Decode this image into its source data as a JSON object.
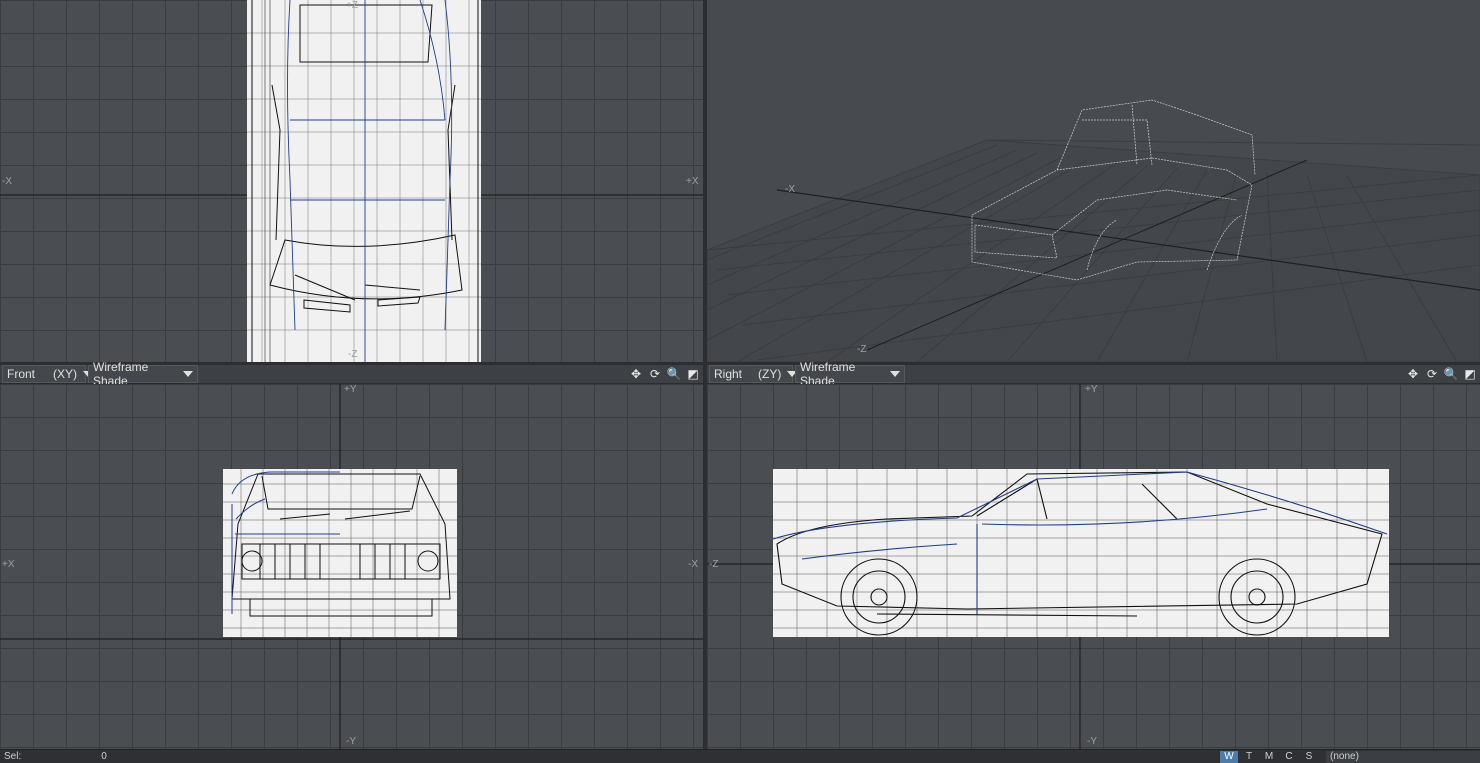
{
  "viewports": {
    "top_left": {
      "axis_labels": {
        "top": "+Z",
        "bottom": "-Z",
        "left": "-X",
        "right": "+X"
      }
    },
    "top_right": {
      "axis_labels": {
        "x": "-X",
        "z": "-Z"
      }
    },
    "bottom_left": {
      "view_name": "Front",
      "view_axes": "(XY)",
      "shade_mode": "Wireframe Shade",
      "axis_labels": {
        "top": "+Y",
        "bottom": "-Y",
        "left": "+X",
        "right": "-X"
      }
    },
    "bottom_right": {
      "view_name": "Right",
      "view_axes": "(ZY)",
      "shade_mode": "Wireframe Shade",
      "axis_labels": {
        "top": "+Y",
        "bottom": "-Y",
        "left": "-Z"
      }
    }
  },
  "tools": {
    "move_icon": "✥",
    "rotate_icon": "⟳",
    "zoom_icon": "🔍",
    "maximize_icon": "◩"
  },
  "status": {
    "sel_label": "Sel:",
    "sel_value": "0",
    "modes": [
      "W",
      "T",
      "M",
      "C",
      "S"
    ],
    "active_mode": "W",
    "layer_select": "(none)"
  },
  "colors": {
    "wire_blue": "#1f3f8a",
    "grid_dark": "#3a3d40",
    "viewport_bg": "#4a4e52",
    "active_mode": "#4d7ca8"
  }
}
